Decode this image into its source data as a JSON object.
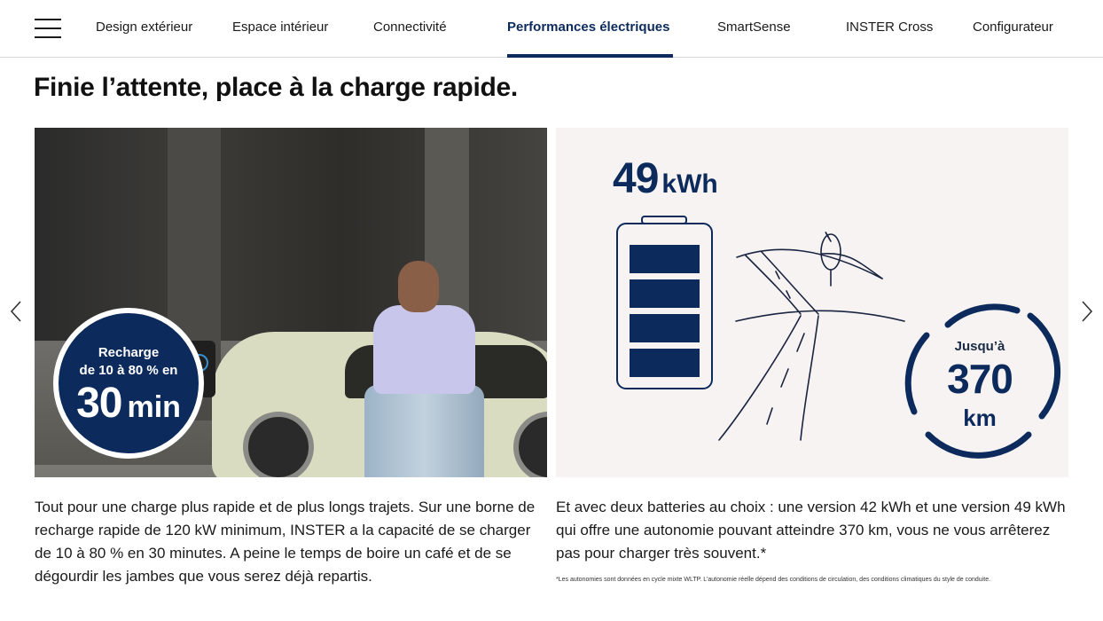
{
  "nav": {
    "items": [
      {
        "label": "Design extérieur"
      },
      {
        "label": "Espace intérieur"
      },
      {
        "label": "Connectivité"
      },
      {
        "label": "Performances électriques"
      },
      {
        "label": "SmartSense"
      },
      {
        "label": "INSTER Cross"
      },
      {
        "label": "Configurateur"
      }
    ],
    "active_index": 3
  },
  "page_title": "Finie l’attente, place à la charge rapide.",
  "left_panel": {
    "badge": {
      "line1": "Recharge",
      "line2": "de 10 à 80 % en",
      "number": "30",
      "unit": "min"
    },
    "body": "Tout pour une charge plus rapide et de plus longs trajets. Sur une borne de recharge rapide de 120 kW minimum, INSTER a la capacité de se charger de 10 à 80 % en 30 minutes. A peine le temps de boire un café et de se dégourdir les jambes que vous serez déjà repartis."
  },
  "right_panel": {
    "battery_number": "49",
    "battery_unit": "kWh",
    "range_prefix": "Jusqu’à",
    "range_number": "370",
    "range_unit": "km",
    "body": "Et avec deux batteries au choix : une version 42 kWh et une version 49 kWh qui offre une autonomie pouvant atteindre 370 km, vous ne vous arrêterez pas pour charger très souvent.*",
    "footnote": "*Les autonomies sont données en cycle mixte WLTP. L’autonomie réelle dépend des conditions de circulation, des conditions climatiques du style de conduite."
  },
  "colors": {
    "brand": "#0c2b5c",
    "illustration_bg": "#f6f3f2"
  }
}
